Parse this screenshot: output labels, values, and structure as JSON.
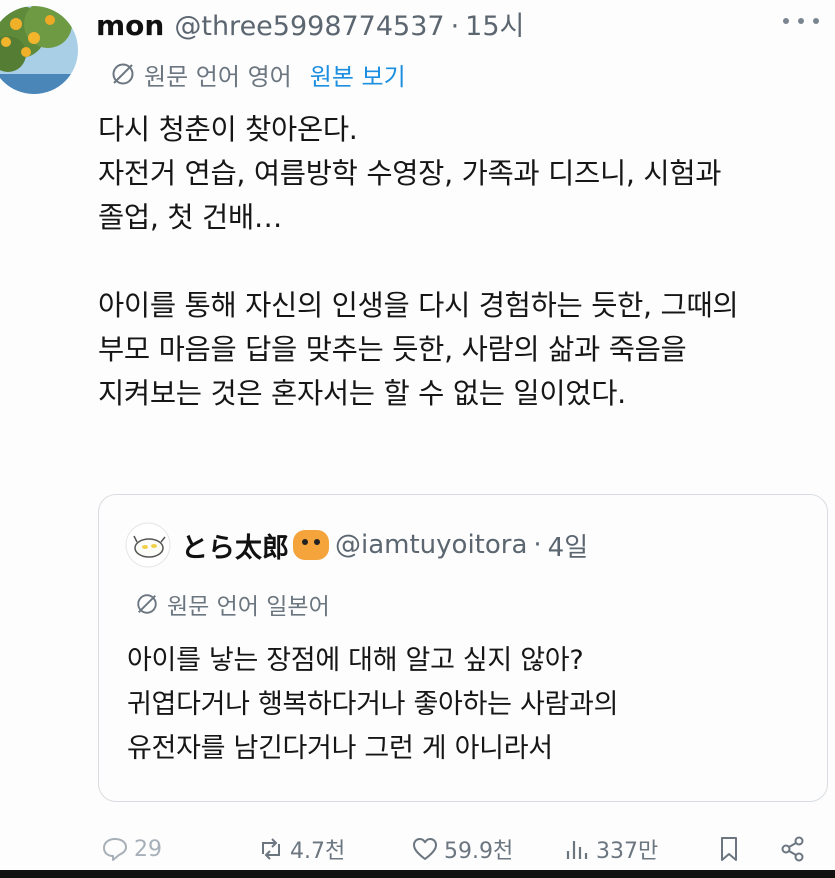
{
  "post": {
    "author_name": "mon",
    "author_handle": "@three5998774537",
    "separator": "·",
    "time": "15시",
    "translate_label": "원문 언어 영어",
    "show_original": "원본 보기",
    "body_lines": [
      "다시 청춘이 찾아온다.",
      "자전거 연습, 여름방학 수영장, 가족과 디즈니, 시험과",
      "졸업, 첫 건배…",
      "",
      "아이를 통해 자신의 인생을 다시 경험하는 듯한, 그때의",
      "부모 마음을 답을 맞추는 듯한, 사람의 삶과 죽음을",
      "지켜보는 것은 혼자서는 할 수 없는 일이었다."
    ]
  },
  "quote": {
    "author_name": "とら太郎",
    "author_emoji": "tiger-face-icon",
    "author_handle": "@iamtuyoitora",
    "separator": "·",
    "time": "4일",
    "translate_label": "원문 언어 일본어",
    "body_lines": [
      "아이를 낳는 장점에 대해 알고 싶지 않아?",
      "귀엽다거나 행복하다거나 좋아하는 사람과의",
      "유전자를 남긴다거나 그런 게 아니라서"
    ]
  },
  "actions": {
    "replies": "29",
    "reposts": "4.7천",
    "likes": "59.9천",
    "views": "337만"
  },
  "colors": {
    "link": "#1d8fe0",
    "muted": "#6b7680",
    "text": "#161616"
  }
}
